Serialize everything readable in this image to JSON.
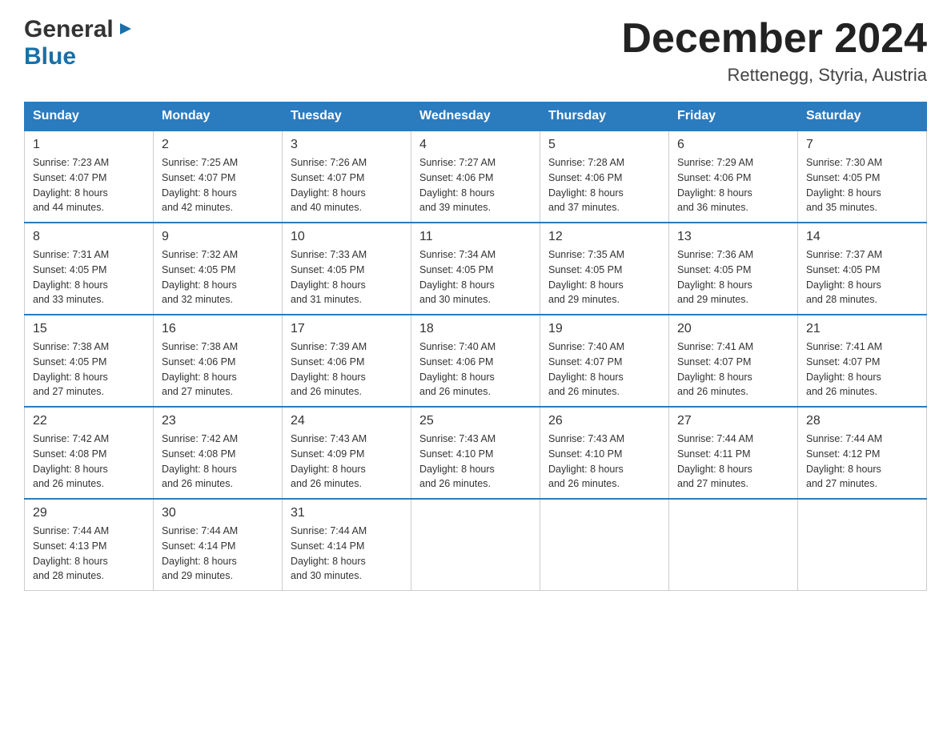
{
  "header": {
    "logo": {
      "general": "General",
      "arrow": "▶",
      "blue": "Blue"
    },
    "month_title": "December 2024",
    "subtitle": "Rettenegg, Styria, Austria"
  },
  "days_of_week": [
    "Sunday",
    "Monday",
    "Tuesday",
    "Wednesday",
    "Thursday",
    "Friday",
    "Saturday"
  ],
  "weeks": [
    [
      {
        "day": "1",
        "sunrise": "7:23 AM",
        "sunset": "4:07 PM",
        "daylight": "8 hours and 44 minutes."
      },
      {
        "day": "2",
        "sunrise": "7:25 AM",
        "sunset": "4:07 PM",
        "daylight": "8 hours and 42 minutes."
      },
      {
        "day": "3",
        "sunrise": "7:26 AM",
        "sunset": "4:07 PM",
        "daylight": "8 hours and 40 minutes."
      },
      {
        "day": "4",
        "sunrise": "7:27 AM",
        "sunset": "4:06 PM",
        "daylight": "8 hours and 39 minutes."
      },
      {
        "day": "5",
        "sunrise": "7:28 AM",
        "sunset": "4:06 PM",
        "daylight": "8 hours and 37 minutes."
      },
      {
        "day": "6",
        "sunrise": "7:29 AM",
        "sunset": "4:06 PM",
        "daylight": "8 hours and 36 minutes."
      },
      {
        "day": "7",
        "sunrise": "7:30 AM",
        "sunset": "4:05 PM",
        "daylight": "8 hours and 35 minutes."
      }
    ],
    [
      {
        "day": "8",
        "sunrise": "7:31 AM",
        "sunset": "4:05 PM",
        "daylight": "8 hours and 33 minutes."
      },
      {
        "day": "9",
        "sunrise": "7:32 AM",
        "sunset": "4:05 PM",
        "daylight": "8 hours and 32 minutes."
      },
      {
        "day": "10",
        "sunrise": "7:33 AM",
        "sunset": "4:05 PM",
        "daylight": "8 hours and 31 minutes."
      },
      {
        "day": "11",
        "sunrise": "7:34 AM",
        "sunset": "4:05 PM",
        "daylight": "8 hours and 30 minutes."
      },
      {
        "day": "12",
        "sunrise": "7:35 AM",
        "sunset": "4:05 PM",
        "daylight": "8 hours and 29 minutes."
      },
      {
        "day": "13",
        "sunrise": "7:36 AM",
        "sunset": "4:05 PM",
        "daylight": "8 hours and 29 minutes."
      },
      {
        "day": "14",
        "sunrise": "7:37 AM",
        "sunset": "4:05 PM",
        "daylight": "8 hours and 28 minutes."
      }
    ],
    [
      {
        "day": "15",
        "sunrise": "7:38 AM",
        "sunset": "4:05 PM",
        "daylight": "8 hours and 27 minutes."
      },
      {
        "day": "16",
        "sunrise": "7:38 AM",
        "sunset": "4:06 PM",
        "daylight": "8 hours and 27 minutes."
      },
      {
        "day": "17",
        "sunrise": "7:39 AM",
        "sunset": "4:06 PM",
        "daylight": "8 hours and 26 minutes."
      },
      {
        "day": "18",
        "sunrise": "7:40 AM",
        "sunset": "4:06 PM",
        "daylight": "8 hours and 26 minutes."
      },
      {
        "day": "19",
        "sunrise": "7:40 AM",
        "sunset": "4:07 PM",
        "daylight": "8 hours and 26 minutes."
      },
      {
        "day": "20",
        "sunrise": "7:41 AM",
        "sunset": "4:07 PM",
        "daylight": "8 hours and 26 minutes."
      },
      {
        "day": "21",
        "sunrise": "7:41 AM",
        "sunset": "4:07 PM",
        "daylight": "8 hours and 26 minutes."
      }
    ],
    [
      {
        "day": "22",
        "sunrise": "7:42 AM",
        "sunset": "4:08 PM",
        "daylight": "8 hours and 26 minutes."
      },
      {
        "day": "23",
        "sunrise": "7:42 AM",
        "sunset": "4:08 PM",
        "daylight": "8 hours and 26 minutes."
      },
      {
        "day": "24",
        "sunrise": "7:43 AM",
        "sunset": "4:09 PM",
        "daylight": "8 hours and 26 minutes."
      },
      {
        "day": "25",
        "sunrise": "7:43 AM",
        "sunset": "4:10 PM",
        "daylight": "8 hours and 26 minutes."
      },
      {
        "day": "26",
        "sunrise": "7:43 AM",
        "sunset": "4:10 PM",
        "daylight": "8 hours and 26 minutes."
      },
      {
        "day": "27",
        "sunrise": "7:44 AM",
        "sunset": "4:11 PM",
        "daylight": "8 hours and 27 minutes."
      },
      {
        "day": "28",
        "sunrise": "7:44 AM",
        "sunset": "4:12 PM",
        "daylight": "8 hours and 27 minutes."
      }
    ],
    [
      {
        "day": "29",
        "sunrise": "7:44 AM",
        "sunset": "4:13 PM",
        "daylight": "8 hours and 28 minutes."
      },
      {
        "day": "30",
        "sunrise": "7:44 AM",
        "sunset": "4:14 PM",
        "daylight": "8 hours and 29 minutes."
      },
      {
        "day": "31",
        "sunrise": "7:44 AM",
        "sunset": "4:14 PM",
        "daylight": "8 hours and 30 minutes."
      },
      null,
      null,
      null,
      null
    ]
  ],
  "labels": {
    "sunrise_prefix": "Sunrise: ",
    "sunset_prefix": "Sunset: ",
    "daylight_prefix": "Daylight: "
  }
}
